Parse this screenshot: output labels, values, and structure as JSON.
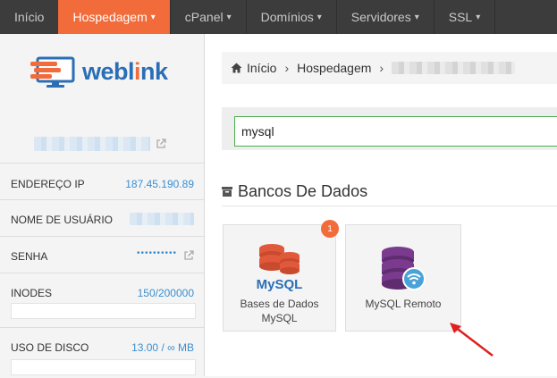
{
  "nav": {
    "items": [
      {
        "label": "Início",
        "caret": ""
      },
      {
        "label": "Hospedagem",
        "caret": "▾"
      },
      {
        "label": "cPanel",
        "caret": "▾"
      },
      {
        "label": "Domínios",
        "caret": "▾"
      },
      {
        "label": "Servidores",
        "caret": "▾"
      },
      {
        "label": "SSL",
        "caret": "▾"
      }
    ],
    "active_color": "#f26b3a"
  },
  "sidebar": {
    "logo_text": "weblink",
    "rows": [
      {
        "label": "ENDEREÇO IP",
        "value": "187.45.190.89"
      },
      {
        "label": "NOME DE USUÁRIO",
        "value": ""
      },
      {
        "label": "SENHA",
        "value": "••••••••••"
      },
      {
        "label": "INODES",
        "value": "150/200000"
      },
      {
        "label": "USO DE DISCO",
        "value": "13.00 / ∞ MB"
      }
    ]
  },
  "main": {
    "breadcrumb": [
      "Início",
      "Hospedagem"
    ],
    "search": {
      "value": "mysql"
    },
    "section_title": "Bancos De Dados",
    "tiles": [
      {
        "label_line1": "Bases de Dados",
        "label_line2": "MySQL",
        "badge": "1",
        "icon_text": "MySQL"
      },
      {
        "label_line1": "MySQL Remoto",
        "label_line2": "",
        "badge": ""
      }
    ]
  },
  "colors": {
    "accent": "#f26b3a",
    "link": "#3b8fd0",
    "mysql_orange": "#e0593a",
    "remote_purple": "#7a3b8f",
    "annotation_red": "#e02020"
  }
}
